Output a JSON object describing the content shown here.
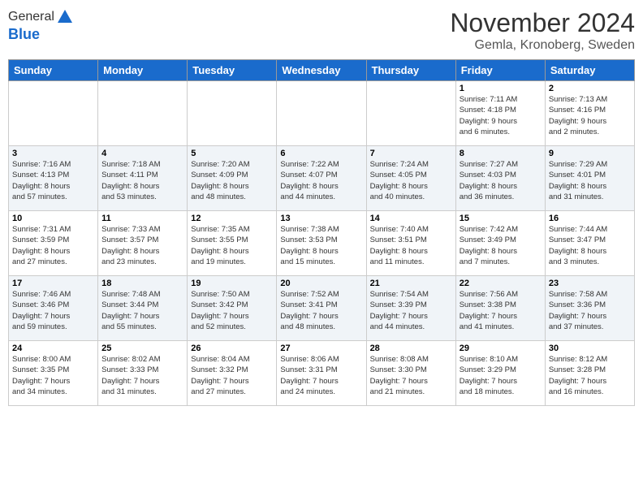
{
  "logo": {
    "general": "General",
    "blue": "Blue"
  },
  "header": {
    "month": "November 2024",
    "location": "Gemla, Kronoberg, Sweden"
  },
  "weekdays": [
    "Sunday",
    "Monday",
    "Tuesday",
    "Wednesday",
    "Thursday",
    "Friday",
    "Saturday"
  ],
  "weeks": [
    [
      {
        "day": "",
        "info": ""
      },
      {
        "day": "",
        "info": ""
      },
      {
        "day": "",
        "info": ""
      },
      {
        "day": "",
        "info": ""
      },
      {
        "day": "",
        "info": ""
      },
      {
        "day": "1",
        "info": "Sunrise: 7:11 AM\nSunset: 4:18 PM\nDaylight: 9 hours\nand 6 minutes."
      },
      {
        "day": "2",
        "info": "Sunrise: 7:13 AM\nSunset: 4:16 PM\nDaylight: 9 hours\nand 2 minutes."
      }
    ],
    [
      {
        "day": "3",
        "info": "Sunrise: 7:16 AM\nSunset: 4:13 PM\nDaylight: 8 hours\nand 57 minutes."
      },
      {
        "day": "4",
        "info": "Sunrise: 7:18 AM\nSunset: 4:11 PM\nDaylight: 8 hours\nand 53 minutes."
      },
      {
        "day": "5",
        "info": "Sunrise: 7:20 AM\nSunset: 4:09 PM\nDaylight: 8 hours\nand 48 minutes."
      },
      {
        "day": "6",
        "info": "Sunrise: 7:22 AM\nSunset: 4:07 PM\nDaylight: 8 hours\nand 44 minutes."
      },
      {
        "day": "7",
        "info": "Sunrise: 7:24 AM\nSunset: 4:05 PM\nDaylight: 8 hours\nand 40 minutes."
      },
      {
        "day": "8",
        "info": "Sunrise: 7:27 AM\nSunset: 4:03 PM\nDaylight: 8 hours\nand 36 minutes."
      },
      {
        "day": "9",
        "info": "Sunrise: 7:29 AM\nSunset: 4:01 PM\nDaylight: 8 hours\nand 31 minutes."
      }
    ],
    [
      {
        "day": "10",
        "info": "Sunrise: 7:31 AM\nSunset: 3:59 PM\nDaylight: 8 hours\nand 27 minutes."
      },
      {
        "day": "11",
        "info": "Sunrise: 7:33 AM\nSunset: 3:57 PM\nDaylight: 8 hours\nand 23 minutes."
      },
      {
        "day": "12",
        "info": "Sunrise: 7:35 AM\nSunset: 3:55 PM\nDaylight: 8 hours\nand 19 minutes."
      },
      {
        "day": "13",
        "info": "Sunrise: 7:38 AM\nSunset: 3:53 PM\nDaylight: 8 hours\nand 15 minutes."
      },
      {
        "day": "14",
        "info": "Sunrise: 7:40 AM\nSunset: 3:51 PM\nDaylight: 8 hours\nand 11 minutes."
      },
      {
        "day": "15",
        "info": "Sunrise: 7:42 AM\nSunset: 3:49 PM\nDaylight: 8 hours\nand 7 minutes."
      },
      {
        "day": "16",
        "info": "Sunrise: 7:44 AM\nSunset: 3:47 PM\nDaylight: 8 hours\nand 3 minutes."
      }
    ],
    [
      {
        "day": "17",
        "info": "Sunrise: 7:46 AM\nSunset: 3:46 PM\nDaylight: 7 hours\nand 59 minutes."
      },
      {
        "day": "18",
        "info": "Sunrise: 7:48 AM\nSunset: 3:44 PM\nDaylight: 7 hours\nand 55 minutes."
      },
      {
        "day": "19",
        "info": "Sunrise: 7:50 AM\nSunset: 3:42 PM\nDaylight: 7 hours\nand 52 minutes."
      },
      {
        "day": "20",
        "info": "Sunrise: 7:52 AM\nSunset: 3:41 PM\nDaylight: 7 hours\nand 48 minutes."
      },
      {
        "day": "21",
        "info": "Sunrise: 7:54 AM\nSunset: 3:39 PM\nDaylight: 7 hours\nand 44 minutes."
      },
      {
        "day": "22",
        "info": "Sunrise: 7:56 AM\nSunset: 3:38 PM\nDaylight: 7 hours\nand 41 minutes."
      },
      {
        "day": "23",
        "info": "Sunrise: 7:58 AM\nSunset: 3:36 PM\nDaylight: 7 hours\nand 37 minutes."
      }
    ],
    [
      {
        "day": "24",
        "info": "Sunrise: 8:00 AM\nSunset: 3:35 PM\nDaylight: 7 hours\nand 34 minutes."
      },
      {
        "day": "25",
        "info": "Sunrise: 8:02 AM\nSunset: 3:33 PM\nDaylight: 7 hours\nand 31 minutes."
      },
      {
        "day": "26",
        "info": "Sunrise: 8:04 AM\nSunset: 3:32 PM\nDaylight: 7 hours\nand 27 minutes."
      },
      {
        "day": "27",
        "info": "Sunrise: 8:06 AM\nSunset: 3:31 PM\nDaylight: 7 hours\nand 24 minutes."
      },
      {
        "day": "28",
        "info": "Sunrise: 8:08 AM\nSunset: 3:30 PM\nDaylight: 7 hours\nand 21 minutes."
      },
      {
        "day": "29",
        "info": "Sunrise: 8:10 AM\nSunset: 3:29 PM\nDaylight: 7 hours\nand 18 minutes."
      },
      {
        "day": "30",
        "info": "Sunrise: 8:12 AM\nSunset: 3:28 PM\nDaylight: 7 hours\nand 16 minutes."
      }
    ]
  ]
}
